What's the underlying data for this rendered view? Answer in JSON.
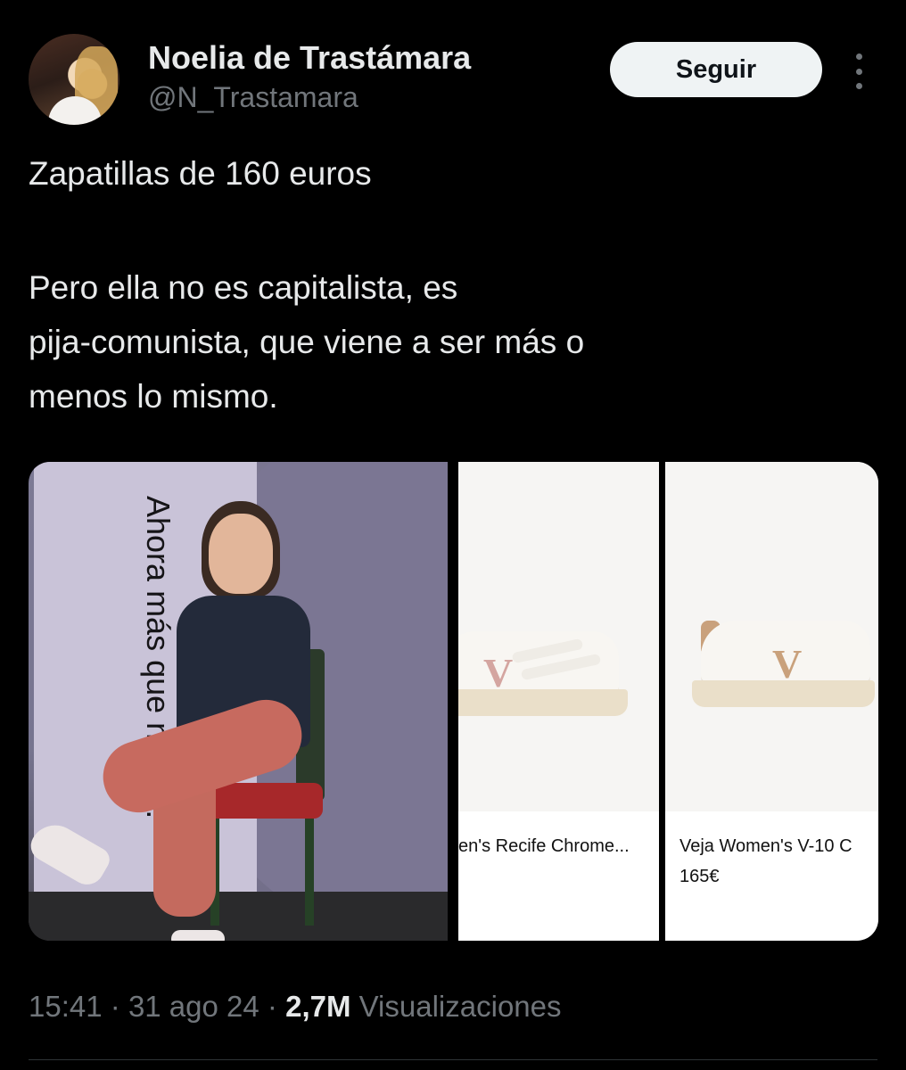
{
  "author": {
    "name": "Noelia de Trastámara",
    "handle": "@N_Trastamara"
  },
  "header": {
    "follow_label": "Seguir"
  },
  "tweet": {
    "lines": [
      "Zapatillas de 160 euros",
      "Pero ella no es capitalista, es",
      "pija-comunista, que viene a ser más o",
      "menos lo mismo."
    ]
  },
  "media": {
    "banner_text": "Ahora más que nunca.",
    "products": [
      {
        "caption": "en's Recife Chrome...",
        "price": ""
      },
      {
        "caption": "Veja Women's V-10 C",
        "price": "165€"
      }
    ]
  },
  "meta": {
    "time": "15:41",
    "sep1": "·",
    "date": "31 ago 24",
    "sep2": "·",
    "views_count": "2,7M",
    "views_label": "Visualizaciones"
  },
  "colors": {
    "background": "#000000",
    "text_primary": "#e7e9ea",
    "text_secondary": "#71767b",
    "follow_button_bg": "#eff3f4"
  },
  "icons": {
    "more": "more-vertical-icon"
  }
}
